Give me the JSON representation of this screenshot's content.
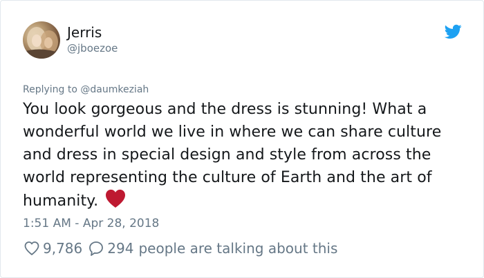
{
  "user": {
    "display_name": "Jerris",
    "handle": "@jboezoe"
  },
  "tweet": {
    "replying_to": "Replying to @daumkeziah",
    "text": "You look gorgeous and the dress is stunning! What a wonderful world we live in where we can share culture and dress in special design and style from across the world representing the culture of Earth and the art of humanity.",
    "emoji": "red-heart",
    "timestamp": "1:51 AM - Apr 28, 2018"
  },
  "engagement": {
    "likes": "9,786",
    "replies": "294",
    "talking_text": "people are talking about this"
  },
  "icons": {
    "brand": "twitter-bird-icon",
    "like": "heart-outline-icon",
    "reply": "speech-bubble-icon"
  },
  "colors": {
    "twitter_blue": "#1da1f2",
    "secondary_text": "#657786",
    "primary_text": "#14171a",
    "heart_red": "#be1931"
  }
}
